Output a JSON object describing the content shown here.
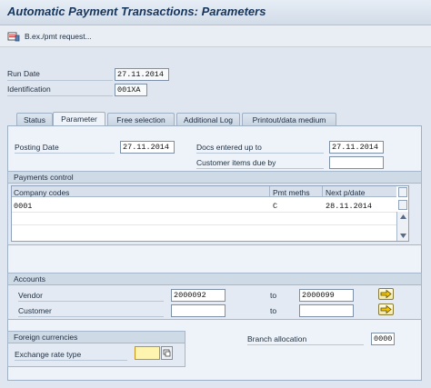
{
  "window": {
    "title": "Automatic Payment Transactions: Parameters"
  },
  "toolbar": {
    "bex_label": "B.ex./pmt request..."
  },
  "header": {
    "run_date_label": "Run Date",
    "run_date_value": "27.11.2014",
    "identification_label": "Identification",
    "identification_value": "001XA"
  },
  "tabs": [
    {
      "label": "Status"
    },
    {
      "label": "Parameter",
      "active": true
    },
    {
      "label": "Free selection"
    },
    {
      "label": "Additional Log"
    },
    {
      "label": "Printout/data medium"
    }
  ],
  "parameters": {
    "posting_date_label": "Posting Date",
    "posting_date_value": "27.11.2014",
    "docs_entered_label": "Docs entered up to",
    "docs_entered_value": "27.11.2014",
    "customer_items_label": "Customer items due by",
    "customer_items_value": ""
  },
  "payments_control": {
    "title": "Payments control",
    "columns": [
      "Company codes",
      "Pmt meths",
      "Next p/date"
    ],
    "rows": [
      {
        "company_codes": "0001",
        "pmt_meths": "C",
        "next_pdate": "28.11.2014"
      }
    ]
  },
  "accounts": {
    "title": "Accounts",
    "vendor_label": "Vendor",
    "vendor_from": "2000092",
    "vendor_to_label": "to",
    "vendor_to": "2000099",
    "customer_label": "Customer",
    "customer_from": "",
    "customer_to_label": "to",
    "customer_to": ""
  },
  "foreign_currencies": {
    "title": "Foreign currencies",
    "exchange_rate_label": "Exchange rate type",
    "exchange_rate_value": ""
  },
  "branch": {
    "label": "Branch allocation",
    "value": "0000"
  },
  "colors": {
    "title_text": "#16355c",
    "active_field": "#fff3b0",
    "background": "#dfe6ef"
  }
}
